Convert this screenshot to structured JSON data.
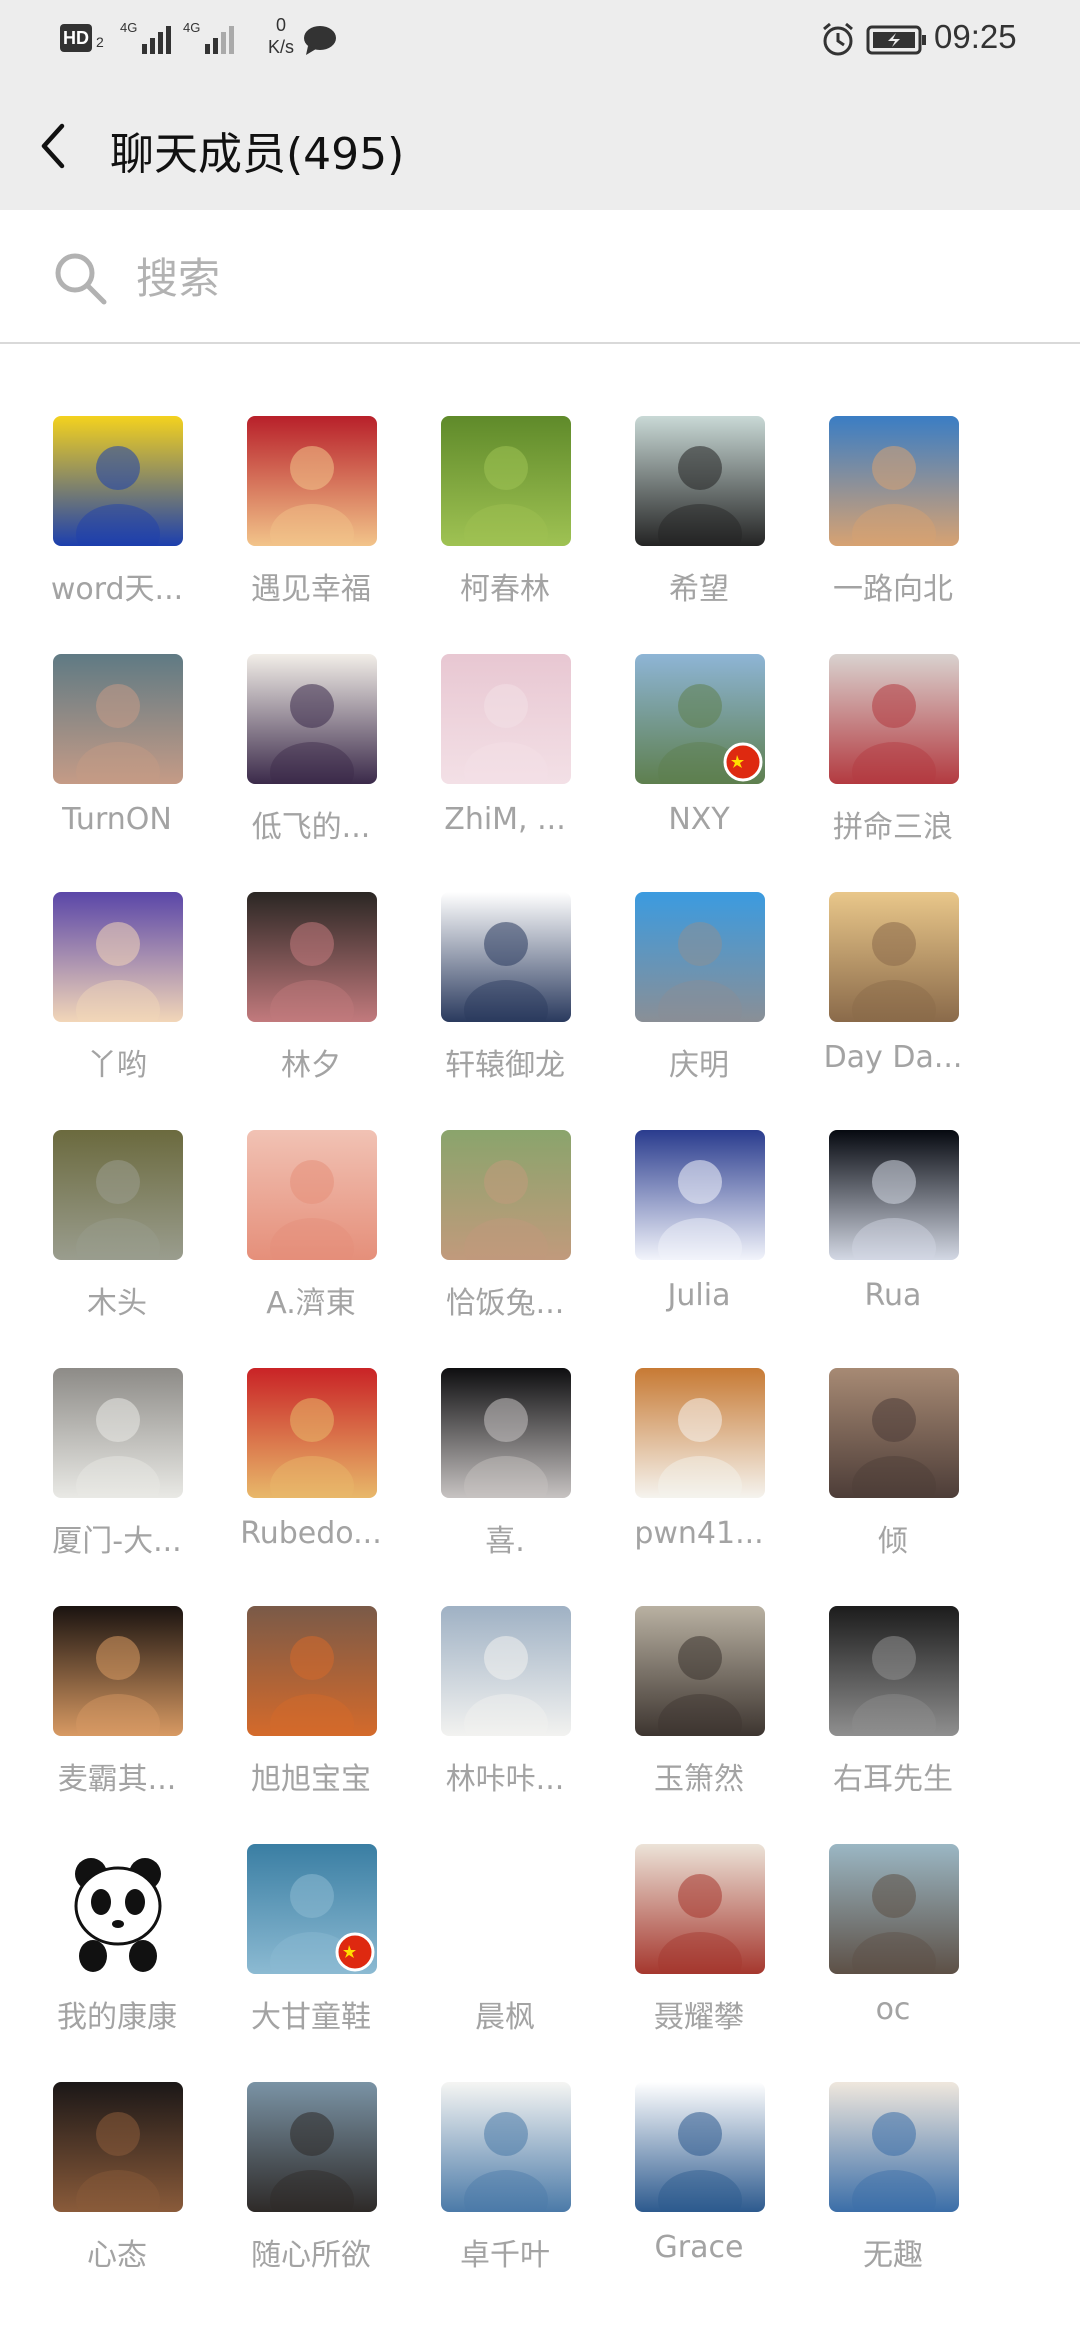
{
  "status_bar": {
    "hd_label": "HD",
    "hd_sub": "2",
    "network_type": "4G",
    "speed_value": "0",
    "speed_unit": "K/s",
    "time": "09:25",
    "icons": [
      "hd-icon",
      "signal-icon",
      "signal-icon",
      "chat-notification-icon",
      "alarm-icon",
      "battery-icon"
    ]
  },
  "header": {
    "back_icon": "chevron-left-icon",
    "title": "聊天成员(495)"
  },
  "search": {
    "icon": "search-icon",
    "placeholder": "搜索"
  },
  "members": [
    {
      "name": "word天...",
      "avatar": "cartoon-boy",
      "colors": [
        "#f4d21e",
        "#1c3fae"
      ]
    },
    {
      "name": "遇见幸福",
      "avatar": "fortune-doll",
      "colors": [
        "#b8202a",
        "#f2c48a"
      ]
    },
    {
      "name": "柯春林",
      "avatar": "tree-field",
      "colors": [
        "#5f8a2a",
        "#9fc253"
      ]
    },
    {
      "name": "希望",
      "avatar": "sunset-sculpture",
      "colors": [
        "#c9d9d6",
        "#242424"
      ]
    },
    {
      "name": "一路向北",
      "avatar": "puppy",
      "colors": [
        "#3a7dc4",
        "#d7a272"
      ]
    },
    {
      "name": "TurnON",
      "avatar": "tattoo-arm",
      "colors": [
        "#5f7a84",
        "#c59b86"
      ]
    },
    {
      "name": "低飞的...",
      "avatar": "anime-guy",
      "colors": [
        "#f2eee8",
        "#3b2a4a"
      ]
    },
    {
      "name": "ZhiM, ...",
      "avatar": "baby",
      "colors": [
        "#e8c7d2",
        "#f3e0e6"
      ]
    },
    {
      "name": "NXY",
      "avatar": "river-flag",
      "colors": [
        "#8eb5d6",
        "#5e7f4e"
      ]
    },
    {
      "name": "拼命三浪",
      "avatar": "umbrella-girl",
      "colors": [
        "#d9d2cf",
        "#b33a40"
      ]
    },
    {
      "name": "丫哟",
      "avatar": "cartoon-avatar",
      "colors": [
        "#5a46a8",
        "#f2d6b8"
      ]
    },
    {
      "name": "林夕",
      "avatar": "dark-portrait",
      "colors": [
        "#2b2724",
        "#c27a7d"
      ]
    },
    {
      "name": "轩辕御龙",
      "avatar": "chibi-boy",
      "colors": [
        "#ffffff",
        "#2a3a5e"
      ]
    },
    {
      "name": "庆明",
      "avatar": "totoro",
      "colors": [
        "#3b9be0",
        "#8a8f96"
      ]
    },
    {
      "name": "Day Da...",
      "avatar": "sunrise-hands",
      "colors": [
        "#e9c78a",
        "#8a6a4a"
      ]
    },
    {
      "name": "木头",
      "avatar": "moss-keyboard",
      "colors": [
        "#6b6a3e",
        "#9a9d8e"
      ]
    },
    {
      "name": "A.濟東",
      "avatar": "pig-toy",
      "colors": [
        "#f1c2b4",
        "#e58f7a"
      ]
    },
    {
      "name": "恰饭兔...",
      "avatar": "man-bird",
      "colors": [
        "#8aa46c",
        "#c19a7c"
      ]
    },
    {
      "name": "Julia",
      "avatar": "moon-departure",
      "colors": [
        "#2a3c8e",
        "#f2f4fb"
      ]
    },
    {
      "name": "Rua",
      "avatar": "galaxy-ring",
      "colors": [
        "#060910",
        "#d3d8e4"
      ]
    },
    {
      "name": "厦门-大...",
      "avatar": "cockatoo",
      "colors": [
        "#8d8b87",
        "#e9e9e5"
      ]
    },
    {
      "name": "Rubedo...",
      "avatar": "new-year-man",
      "colors": [
        "#c92326",
        "#e8b86a"
      ]
    },
    {
      "name": "喜.",
      "avatar": "man-cap",
      "colors": [
        "#0e0e10",
        "#c7c3c2"
      ]
    },
    {
      "name": "pwn41...",
      "avatar": "orange-cat",
      "colors": [
        "#c77a34",
        "#f5f3ee"
      ]
    },
    {
      "name": "倾",
      "avatar": "mountain-sunset",
      "colors": [
        "#a78a74",
        "#4d3d38"
      ]
    },
    {
      "name": "麦霸其...",
      "avatar": "young-man",
      "colors": [
        "#1a1310",
        "#d89a63"
      ]
    },
    {
      "name": "旭旭宝宝",
      "avatar": "dancing-man",
      "colors": [
        "#7a5a48",
        "#d46a2b"
      ]
    },
    {
      "name": "林咔咔...",
      "avatar": "penguins",
      "colors": [
        "#9fb1c4",
        "#f2f2f0"
      ]
    },
    {
      "name": "玉箫然",
      "avatar": "anime-man",
      "colors": [
        "#b9b1a2",
        "#3d3530"
      ]
    },
    {
      "name": "右耳先生",
      "avatar": "bw-portrait",
      "colors": [
        "#1c1c1c",
        "#8f8f8f"
      ]
    },
    {
      "name": "我的康康",
      "avatar": "panda",
      "colors": [
        "#ffffff",
        "#111111"
      ]
    },
    {
      "name": "大甘童鞋",
      "avatar": "lake-flag",
      "colors": [
        "#3a7ea3",
        "#8cbad2"
      ]
    },
    {
      "name": "晨枫",
      "avatar": "blank",
      "colors": [
        "#ffffff",
        "#ffffff"
      ]
    },
    {
      "name": "聂耀攀",
      "avatar": "white-puppy",
      "colors": [
        "#ece3d8",
        "#a5372e"
      ]
    },
    {
      "name": "oc",
      "avatar": "beach-man",
      "colors": [
        "#9bb7c4",
        "#5d5046"
      ]
    },
    {
      "name": "心态",
      "avatar": "night-city",
      "colors": [
        "#1b1717",
        "#8a5b3a"
      ]
    },
    {
      "name": "随心所欲",
      "avatar": "curly-cartoon",
      "colors": [
        "#7a93a5",
        "#2e2a28"
      ]
    },
    {
      "name": "卓千叶",
      "avatar": "small-painting",
      "colors": [
        "#f5f5f3",
        "#4b7aa8"
      ]
    },
    {
      "name": "Grace",
      "avatar": "double-exposure",
      "colors": [
        "#ffffff",
        "#2d5a8e"
      ]
    },
    {
      "name": "无趣",
      "avatar": "figures-sketch",
      "colors": [
        "#efe7dd",
        "#3b6ea8"
      ]
    }
  ]
}
